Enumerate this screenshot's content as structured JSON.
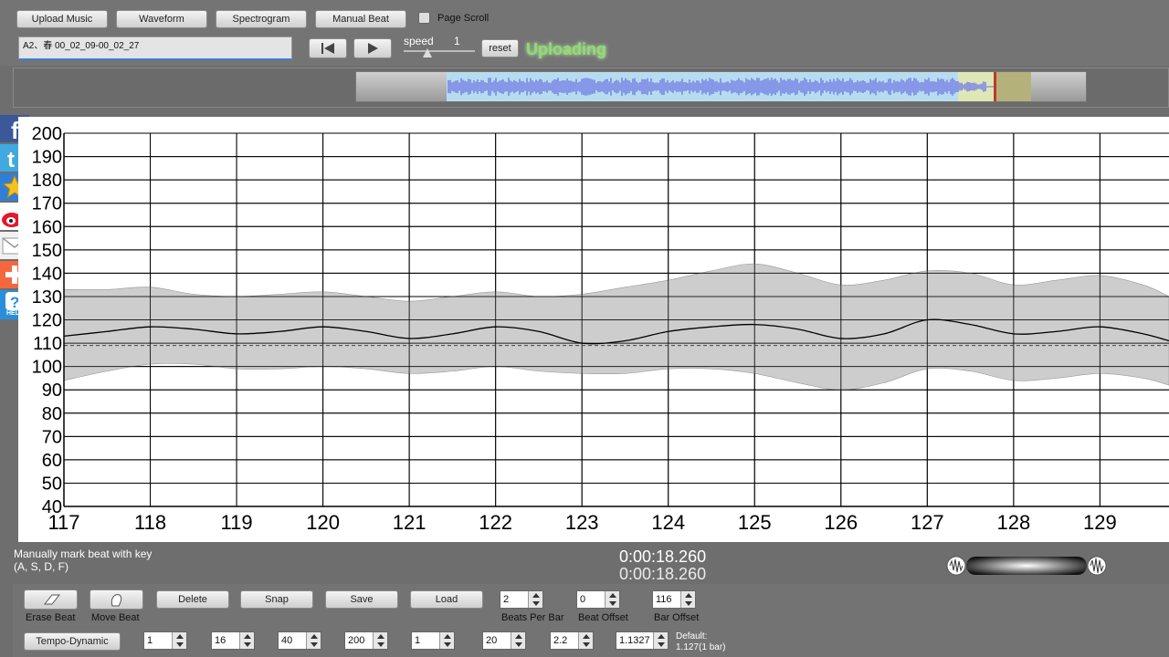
{
  "toolbar": {
    "upload_label": "Upload Music",
    "waveform_label": "Waveform",
    "spectrogram_label": "Spectrogram",
    "manual_beat_label": "Manual Beat",
    "page_scroll_label": "Page Scroll",
    "page_scroll_checked": false,
    "file_name": "A2、春 00_02_09-00_02_27",
    "speed_label": "speed",
    "speed_value": "1",
    "reset_label": "reset",
    "status": "Uploading"
  },
  "social": [
    "facebook-icon",
    "twitter-icon",
    "favorite-star-icon",
    "weibo-icon",
    "email-icon",
    "add-share-icon",
    "help-icon"
  ],
  "help_text": "HELP",
  "chart_data": {
    "type": "area",
    "title": "",
    "xlabel": "",
    "ylabel": "",
    "xlim": [
      117,
      129.8
    ],
    "ylim": [
      40,
      200
    ],
    "xticks": [
      117,
      118,
      119,
      120,
      121,
      122,
      123,
      124,
      125,
      126,
      127,
      128,
      129
    ],
    "yticks": [
      200,
      190,
      180,
      170,
      160,
      150,
      140,
      130,
      120,
      110,
      100,
      90,
      80,
      70,
      60,
      50,
      40
    ],
    "grid": true,
    "reference_line": 109,
    "x": [
      117,
      117.5,
      118,
      118.5,
      119,
      119.5,
      120,
      120.5,
      121,
      121.5,
      122,
      122.5,
      123,
      123.5,
      124,
      124.5,
      125,
      125.5,
      126,
      126.5,
      127,
      127.5,
      128,
      128.5,
      129,
      129.5,
      129.8
    ],
    "series": [
      {
        "name": "",
        "role": "upper",
        "values": [
          133,
          133,
          134,
          131,
          130,
          131,
          132,
          130,
          128,
          130,
          132,
          130,
          131,
          134,
          137,
          141,
          144,
          140,
          135,
          137,
          141,
          140,
          135,
          137,
          139,
          135,
          130
        ]
      },
      {
        "name": "",
        "role": "tempo",
        "values": [
          113,
          115,
          117,
          116,
          114,
          115,
          117,
          115,
          112,
          114,
          117,
          115,
          110,
          111,
          115,
          117,
          118,
          116,
          112,
          114,
          120,
          118,
          114,
          115,
          117,
          114,
          111
        ]
      },
      {
        "name": "",
        "role": "lower",
        "values": [
          94,
          98,
          101,
          101,
          99,
          99,
          100,
          99,
          97,
          98,
          100,
          98,
          97,
          97,
          99,
          99,
          97,
          93,
          90,
          93,
          99,
          98,
          94,
          95,
          97,
          95,
          92
        ]
      }
    ]
  },
  "status": {
    "hint_line1": "Manually mark beat with key",
    "hint_line2": "(A, S, D, F)",
    "time_top": "0:00:18.260",
    "time_bottom": "0:00:18.260"
  },
  "bottom": {
    "erase_beat": "Erase Beat",
    "move_beat": "Move Beat",
    "delete": "Delete",
    "snap": "Snap",
    "save": "Save",
    "load": "Load",
    "beats_per_bar_value": "2",
    "beats_per_bar_label": "Beats Per Bar",
    "beat_offset_value": "0",
    "beat_offset_label": "Beat Offset",
    "bar_offset_value": "116",
    "bar_offset_label": "Bar Offset",
    "tempo_dynamic": "Tempo-Dynamic",
    "field1": "1",
    "field2": "16",
    "field3": "40",
    "field4": "200",
    "field5": "1",
    "field6": "20",
    "field7": "2.2",
    "field8": "1.1327",
    "default_line1": "Default:",
    "default_line2": "1.127(1 bar)"
  }
}
